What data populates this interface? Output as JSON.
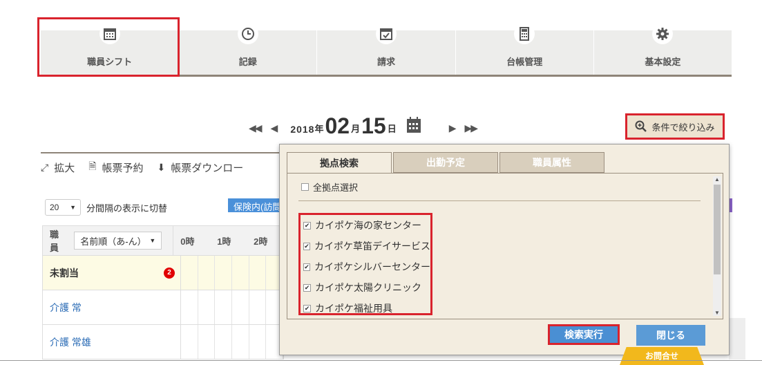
{
  "nav": {
    "items": [
      {
        "label": "職員シフト",
        "icon": "calendar-grid-icon"
      },
      {
        "label": "記録",
        "icon": "clock-icon"
      },
      {
        "label": "請求",
        "icon": "calendar-check-icon"
      },
      {
        "label": "台帳管理",
        "icon": "calculator-icon"
      },
      {
        "label": "基本設定",
        "icon": "gear-icon"
      }
    ]
  },
  "date": {
    "year": "2018",
    "year_unit": "年",
    "month": "02",
    "month_unit": "月",
    "day": "15",
    "day_unit": "日"
  },
  "filter": {
    "label": "条件で絞り込み"
  },
  "toolbar": {
    "expand": "拡大",
    "reserve": "帳票予約",
    "download": "帳票ダウンロー"
  },
  "interval": {
    "value": "20",
    "label": "分間隔の表示に切替"
  },
  "badge": {
    "label": "保険内(訪問"
  },
  "table": {
    "staff_label": "職員",
    "sort": "名前順（あ-ん）",
    "hours": [
      "0時",
      "1時",
      "2時"
    ],
    "rows": [
      {
        "name": "未割当",
        "count": "2"
      },
      {
        "name": "介護 常"
      },
      {
        "name": "介護 常雄"
      }
    ]
  },
  "dialog": {
    "tabs": [
      "拠点検索",
      "出勤予定",
      "職員属性"
    ],
    "select_all": "全拠点選択",
    "offices": [
      "カイポケ海の家センター",
      "カイポケ草笛デイサービス",
      "カイポケシルバーセンター",
      "カイポケ太陽クリニック",
      "カイポケ福祉用具"
    ],
    "search_button": "検索実行",
    "close_button": "閉じる"
  },
  "contact": {
    "label": "お問合せ"
  },
  "colors": {
    "accent_red": "#d9232d",
    "button_blue": "#4a8fd3",
    "brown": "#8e8478"
  }
}
